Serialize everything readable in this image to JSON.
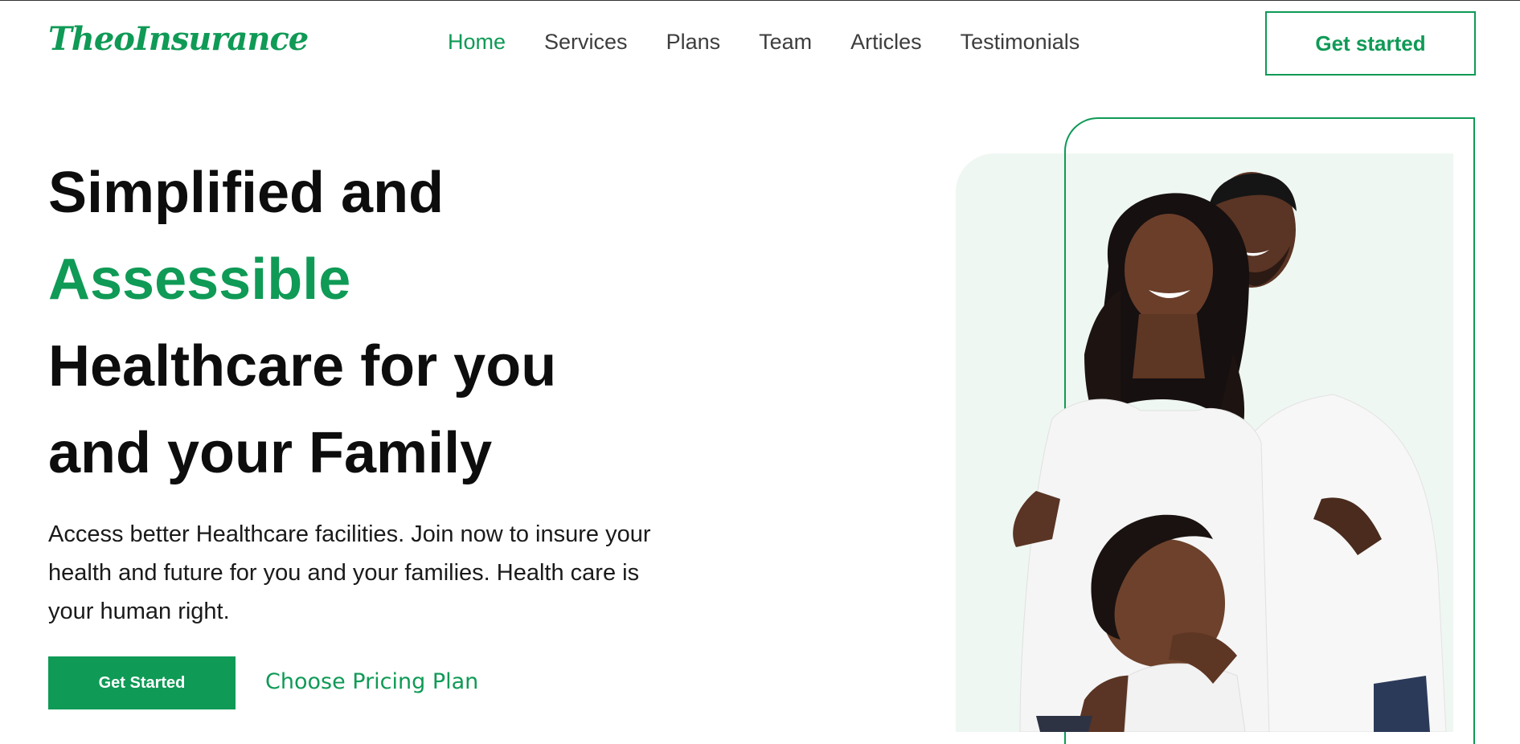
{
  "header": {
    "logo": "TheoInsurance",
    "nav": [
      "Home",
      "Services",
      "Plans",
      "Team",
      "Articles",
      "Testimonials"
    ],
    "active_nav": "Home",
    "cta_label": "Get started"
  },
  "hero": {
    "title_line1": "Simplified and",
    "title_accent": "Assessible",
    "title_rest": " Healthcare for you and your Family",
    "description": "Access better Healthcare facilities. Join now to insure your health and future for you and your families. Health care is your human right.",
    "primary_label": "Get Started",
    "secondary_label": "Choose Pricing Plan"
  },
  "colors": {
    "brand_green": "#0f9a56",
    "photo_bg": "#eff7f2"
  }
}
